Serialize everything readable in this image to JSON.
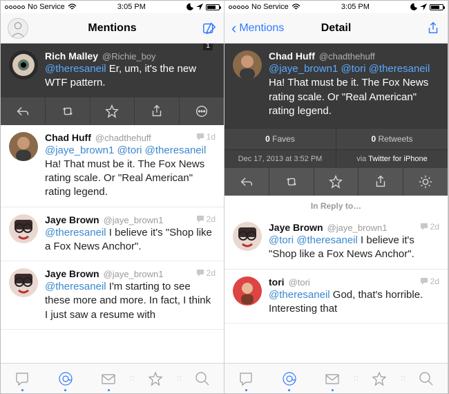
{
  "status": {
    "carrier": "No Service",
    "time": "3:05 PM"
  },
  "left": {
    "title": "Mentions",
    "badge": "1",
    "featured": {
      "name": "Rich Malley",
      "handle": "@Richie_boy",
      "mention": "@theresaneil",
      "text": " Er, um, it's the new WTF pattern."
    },
    "tweets": [
      {
        "name": "Chad Huff",
        "handle": "@chadthehuff",
        "age": "1d",
        "mentions": "@jaye_brown1 @tori @theresaneil",
        "text": " Ha! That must be it. The Fox News rating scale. Or \"Real American\" rating legend."
      },
      {
        "name": "Jaye Brown",
        "handle": "@jaye_brown1",
        "age": "2d",
        "mentions": "@theresaneil",
        "text": " I believe it's \"Shop like a Fox News Anchor\"."
      },
      {
        "name": "Jaye Brown",
        "handle": "@jaye_brown1",
        "age": "2d",
        "mentions": "@theresaneil",
        "text": " I'm starting to see these more and more. In fact, I think I just saw a resume with"
      }
    ]
  },
  "right": {
    "back": "Mentions",
    "title": "Detail",
    "tweet": {
      "name": "Chad Huff",
      "handle": "@chadthehuff",
      "mentions": "@jaye_brown1 @tori @theresaneil",
      "text": " Ha! That must be it. The Fox News rating scale. Or \"Real American\" rating legend."
    },
    "stats": {
      "faves_num": "0",
      "faves_label": " Faves",
      "rt_num": "0",
      "rt_label": " Retweets"
    },
    "tsrow": {
      "timestamp": "Dec 17, 2013 at 3:52 PM",
      "via_prefix": "via ",
      "via": "Twitter for iPhone"
    },
    "in_reply": "In Reply to…",
    "replies": [
      {
        "name": "Jaye Brown",
        "handle": "@jaye_brown1",
        "age": "2d",
        "mentions": "@tori @theresaneil",
        "text": " I believe it's \"Shop like a Fox News Anchor\"."
      },
      {
        "name": "tori",
        "handle": "@tori",
        "age": "2d",
        "mentions": "@theresaneil",
        "text": " God, that's horrible. Interesting that"
      }
    ]
  }
}
